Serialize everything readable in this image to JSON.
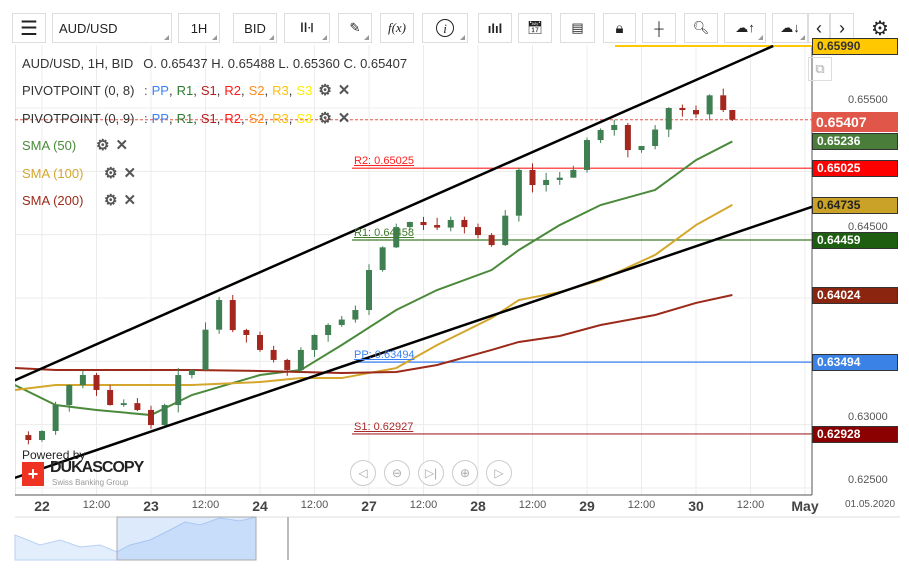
{
  "toolbar": {
    "symbol": "AUD/USD",
    "timeframe": "1H",
    "side": "BID",
    "icons": [
      "menu-icon",
      "candlestick-icon",
      "pencil-icon",
      "function-icon",
      "info-icon",
      "bar-chart-icon",
      "calendar-icon",
      "report-icon",
      "lock-icon",
      "crosshair-icon",
      "zoom-chart-icon",
      "upload-cloud-icon",
      "download-cloud-icon",
      "chevron-left-icon",
      "chevron-right-icon",
      "gear-icon"
    ],
    "fx_label": "f(x)"
  },
  "legend": {
    "header": "AUD/USD, 1H, BID",
    "ohlc": "O. 0.65437 H. 0.65488 L. 0.65360 C. 0.65407",
    "pivots": [
      {
        "name": "PIVOTPOINT (0, 8)",
        "sep": ":"
      },
      {
        "name": "PIVOTPOINT (0, 9)",
        "sep": ":"
      }
    ],
    "pivot_items": [
      {
        "label": "PP",
        "color": "#3b82f6"
      },
      {
        "label": "R1",
        "color": "#2e7d32"
      },
      {
        "label": "S1",
        "color": "#b71c1c"
      },
      {
        "label": "R2",
        "color": "#ff1a1a"
      },
      {
        "label": "S2",
        "color": "#ff8c1a"
      },
      {
        "label": "R3",
        "color": "#ffc107"
      },
      {
        "label": "S3",
        "color": "#ffee00"
      }
    ],
    "smas": [
      {
        "name": "SMA (50)",
        "color": "#4a8a3a"
      },
      {
        "name": "SMA (100)",
        "color": "#d4a72c"
      },
      {
        "name": "SMA (200)",
        "color": "#9b2a1a"
      }
    ]
  },
  "chart_data": {
    "type": "candlestick",
    "ylim": [
      0.625,
      0.6599
    ],
    "price_axis_labels": [
      "0.65500",
      "0.64500",
      "0.63000",
      "0.62500"
    ],
    "time_axis": [
      {
        "label": "22",
        "t": "04-22 00:00",
        "day": true
      },
      {
        "label": "12:00",
        "t": "04-22 12:00"
      },
      {
        "label": "23",
        "t": "04-23 00:00",
        "day": true
      },
      {
        "label": "12:00",
        "t": "04-23 12:00"
      },
      {
        "label": "24",
        "t": "04-24 00:00",
        "day": true
      },
      {
        "label": "12:00",
        "t": "04-24 12:00"
      },
      {
        "label": "27",
        "t": "04-27 00:00",
        "day": true
      },
      {
        "label": "12:00",
        "t": "04-27 12:00"
      },
      {
        "label": "28",
        "t": "04-28 00:00",
        "day": true
      },
      {
        "label": "12:00",
        "t": "04-28 12:00"
      },
      {
        "label": "29",
        "t": "04-29 00:00",
        "day": true
      },
      {
        "label": "12:00",
        "t": "04-29 12:00"
      },
      {
        "label": "30",
        "t": "04-30 00:00",
        "day": true
      },
      {
        "label": "12:00",
        "t": "04-30 12:00"
      },
      {
        "label": "May",
        "t": "05-01 00:00",
        "day": true
      }
    ],
    "end_date": "01.05.2020",
    "closes": [
      [
        "04-21 18:00",
        0.62918
      ],
      [
        "04-21 21:00",
        0.62879
      ],
      [
        "04-22 00:00",
        0.6295
      ],
      [
        "04-22 03:00",
        0.63155
      ],
      [
        "04-22 06:00",
        0.63313
      ],
      [
        "04-22 09:00",
        0.63392
      ],
      [
        "04-22 12:00",
        0.63274
      ],
      [
        "04-22 15:00",
        0.63155
      ],
      [
        "04-22 18:00",
        0.6317
      ],
      [
        "04-22 21:00",
        0.63116
      ],
      [
        "04-23 00:00",
        0.62997
      ],
      [
        "04-23 03:00",
        0.63155
      ],
      [
        "04-23 06:00",
        0.63392
      ],
      [
        "04-23 09:00",
        0.63432
      ],
      [
        "04-23 12:00",
        0.6375
      ],
      [
        "04-23 15:00",
        0.63984
      ],
      [
        "04-23 18:00",
        0.63747
      ],
      [
        "04-23 21:00",
        0.63708
      ],
      [
        "04-24 00:00",
        0.6359
      ],
      [
        "04-24 03:00",
        0.63511
      ],
      [
        "04-24 06:00",
        0.63432
      ],
      [
        "04-24 09:00",
        0.6359
      ],
      [
        "04-24 12:00",
        0.63708
      ],
      [
        "04-24 15:00",
        0.63787
      ],
      [
        "04-24 18:00",
        0.6383
      ],
      [
        "04-24 21:00",
        0.63905
      ],
      [
        "04-27 00:00",
        0.64221
      ],
      [
        "04-27 03:00",
        0.644
      ],
      [
        "04-27 06:00",
        0.6456
      ],
      [
        "04-27 09:00",
        0.646
      ],
      [
        "04-27 12:00",
        0.64576
      ],
      [
        "04-27 15:00",
        0.64556
      ],
      [
        "04-27 18:00",
        0.64616
      ],
      [
        "04-27 21:00",
        0.6456
      ],
      [
        "04-28 00:00",
        0.64497
      ],
      [
        "04-28 03:00",
        0.64418
      ],
      [
        "04-28 06:00",
        0.6465
      ],
      [
        "04-28 09:00",
        0.65011
      ],
      [
        "04-28 12:00",
        0.64892
      ],
      [
        "04-28 15:00",
        0.64932
      ],
      [
        "04-28 18:00",
        0.6495
      ],
      [
        "04-28 21:00",
        0.65011
      ],
      [
        "04-29 00:00",
        0.65247
      ],
      [
        "04-29 03:00",
        0.65326
      ],
      [
        "04-29 06:00",
        0.65366
      ],
      [
        "04-29 09:00",
        0.65168
      ],
      [
        "04-29 12:00",
        0.652
      ],
      [
        "04-29 15:00",
        0.6533
      ],
      [
        "04-29 18:00",
        0.655
      ],
      [
        "04-29 21:00",
        0.65484
      ],
      [
        "04-30 00:00",
        0.6545
      ],
      [
        "04-30 03:00",
        0.656
      ],
      [
        "04-30 06:00",
        0.65484
      ],
      [
        "04-30 08:00",
        0.65407
      ]
    ],
    "sma_times": [
      "04-21 18:00",
      "04-22 03:00",
      "04-22 12:00",
      "04-23 00:00",
      "04-23 09:00",
      "04-24 00:00",
      "04-24 09:00",
      "04-24 18:00",
      "04-27 06:00",
      "04-27 15:00",
      "04-28 03:00",
      "04-28 09:00",
      "04-28 18:00",
      "04-29 03:00",
      "04-29 15:00",
      "04-30 00:00",
      "04-30 08:00"
    ],
    "series": [
      {
        "name": "SMA (50)",
        "color": "#4a8a3a",
        "values": [
          0.63313,
          0.63155,
          0.63116,
          0.63076,
          0.63234,
          0.63392,
          0.63432,
          0.63629,
          0.63905,
          0.64063,
          0.64221,
          0.64379,
          0.64576,
          0.64734,
          0.64853,
          0.65089,
          0.65236
        ]
      },
      {
        "name": "SMA (100)",
        "color": "#d4a72c",
        "values": [
          0.63274,
          0.63313,
          0.63313,
          0.63313,
          0.63313,
          0.63337,
          0.63368,
          0.63368,
          0.63447,
          0.63629,
          0.63842,
          0.63984,
          0.64047,
          0.64142,
          0.6434,
          0.64576,
          0.64735
        ]
      },
      {
        "name": "SMA (200)",
        "color": "#9b2a1a",
        "values": [
          0.63447,
          0.63432,
          0.63432,
          0.63432,
          0.63432,
          0.63424,
          0.63416,
          0.63408,
          0.63416,
          0.63471,
          0.6359,
          0.63653,
          0.637,
          0.63787,
          0.63866,
          0.63961,
          0.64024
        ]
      }
    ],
    "trendlines": [
      {
        "from": [
          "04-21 18:00",
          0.6335
        ],
        "to": [
          "04-30 17:00",
          0.6599
        ]
      },
      {
        "from": [
          "04-21 18:00",
          0.6258
        ],
        "to": [
          "05-01 02:00",
          0.6472
        ]
      }
    ],
    "pivot_lines": [
      {
        "label": "R2: 0.65025",
        "value": 0.65025,
        "color": "#ff2020"
      },
      {
        "label": "R1: 0.64458",
        "value": 0.64458,
        "color": "#3f7a2a"
      },
      {
        "label": "PP: 0.63494",
        "value": 0.63494,
        "color": "#3b82f6"
      },
      {
        "label": "S1: 0.62927",
        "value": 0.62927,
        "color": "#a52a2a"
      }
    ],
    "price_tags": [
      {
        "text": "0.65990",
        "value": 0.6599,
        "bg": "#ffc800",
        "fg": "#333"
      },
      {
        "text": "0.65407",
        "value": 0.65407,
        "bg": "#e0574a",
        "fg": "#fff"
      },
      {
        "text": "0.65236",
        "value": 0.65236,
        "bg": "#4a7c3a",
        "fg": "#fff"
      },
      {
        "text": "0.65025",
        "value": 0.65025,
        "bg": "#ff0000",
        "fg": "#fff"
      },
      {
        "text": "0.64735",
        "value": 0.64735,
        "bg": "#c9a227",
        "fg": "#222"
      },
      {
        "text": "0.64459",
        "value": 0.64459,
        "bg": "#1e5e10",
        "fg": "#fff"
      },
      {
        "text": "0.64024",
        "value": 0.64024,
        "bg": "#8b2510",
        "fg": "#fff"
      },
      {
        "text": "0.63494",
        "value": 0.63494,
        "bg": "#3b82e6",
        "fg": "#fff"
      },
      {
        "text": "0.62928",
        "value": 0.62928,
        "bg": "#8b0000",
        "fg": "#fff"
      }
    ],
    "last_price": 0.65407,
    "colors": {
      "up": "#3f7f52",
      "down": "#a3271f"
    }
  },
  "branding": {
    "powered_by": "Powered by",
    "name": "DUKASCOPY",
    "tagline": "Swiss Banking Group"
  }
}
